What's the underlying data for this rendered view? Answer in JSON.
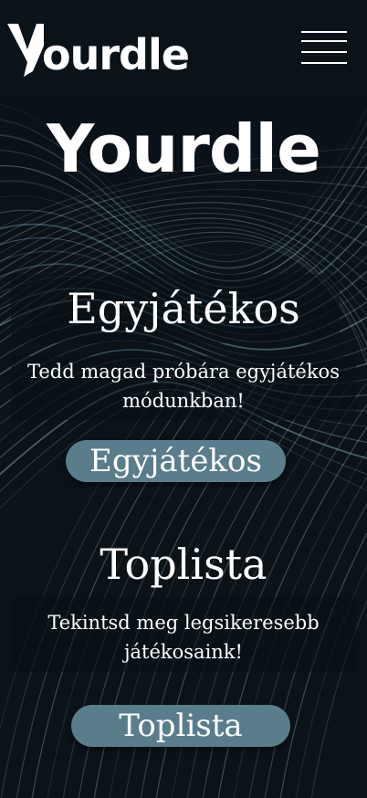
{
  "header": {
    "logo_text": "ourdle",
    "logo_icon": "y-logo-mark",
    "menu_icon": "hamburger-menu-icon"
  },
  "hero": {
    "title": "Yourdle"
  },
  "single": {
    "title": "Egyjátékos",
    "desc_line1": "Tedd magad próbára egyjátékos",
    "desc_line2": "módunkban!",
    "button": "Egyjátékos"
  },
  "leaderboard": {
    "title": "Toplista",
    "desc_line1": "Tekintsd meg legsikeresebb",
    "desc_line2": "játékosaink!",
    "button": "Toplista"
  },
  "colors": {
    "background": "#0b1218",
    "button": "#5a7d8b",
    "text": "#ffffff"
  }
}
